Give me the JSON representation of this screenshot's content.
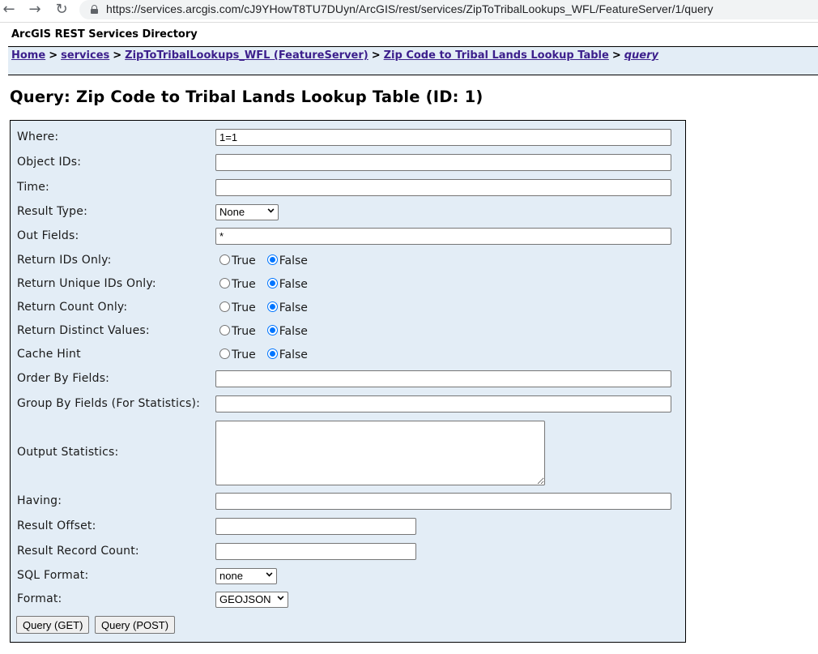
{
  "browser": {
    "url": "https://services.arcgis.com/cJ9YHowT8TU7DUyn/ArcGIS/rest/services/ZipToTribalLookups_WFL/FeatureServer/1/query",
    "icons": [
      "back-arrow-icon",
      "forward-arrow-icon",
      "reload-icon",
      "lock-icon"
    ]
  },
  "header": {
    "directory_title": "ArcGIS REST Services Directory"
  },
  "breadcrumb": {
    "items": [
      {
        "label": "Home"
      },
      {
        "label": "services"
      },
      {
        "label": "ZipToTribalLookups_WFL (FeatureServer)"
      },
      {
        "label": "Zip Code to Tribal Lands Lookup Table"
      },
      {
        "label": "query"
      }
    ],
    "separator": ">"
  },
  "page": {
    "title": "Query: Zip Code to Tribal Lands Lookup Table (ID: 1)"
  },
  "form": {
    "where": {
      "label": "Where:",
      "value": "1=1"
    },
    "object_ids": {
      "label": "Object IDs:",
      "value": ""
    },
    "time": {
      "label": "Time:",
      "value": ""
    },
    "result_type": {
      "label": "Result Type:",
      "selected": "None"
    },
    "out_fields": {
      "label": "Out Fields:",
      "value": "*"
    },
    "return_ids_only": {
      "label": "Return IDs Only:",
      "true_label": "True",
      "false_label": "False",
      "selected": "False"
    },
    "return_unique_ids_only": {
      "label": "Return Unique IDs Only:",
      "true_label": "True",
      "false_label": "False",
      "selected": "False"
    },
    "return_count_only": {
      "label": "Return Count Only:",
      "true_label": "True",
      "false_label": "False",
      "selected": "False"
    },
    "return_distinct_values": {
      "label": "Return Distinct Values:",
      "true_label": "True",
      "false_label": "False",
      "selected": "False"
    },
    "cache_hint": {
      "label": "Cache Hint",
      "true_label": "True",
      "false_label": "False",
      "selected": "False"
    },
    "order_by_fields": {
      "label": "Order By Fields:",
      "value": ""
    },
    "group_by_fields": {
      "label": "Group By Fields (For Statistics):",
      "value": ""
    },
    "output_statistics": {
      "label": "Output Statistics:",
      "value": ""
    },
    "having": {
      "label": "Having:",
      "value": ""
    },
    "result_offset": {
      "label": "Result Offset:",
      "value": ""
    },
    "result_record_count": {
      "label": "Result Record Count:",
      "value": ""
    },
    "sql_format": {
      "label": "SQL Format:",
      "selected": "none"
    },
    "format": {
      "label": "Format:",
      "selected": "GEOJSON"
    },
    "buttons": {
      "query_get": "Query (GET)",
      "query_post": "Query (POST)"
    }
  }
}
